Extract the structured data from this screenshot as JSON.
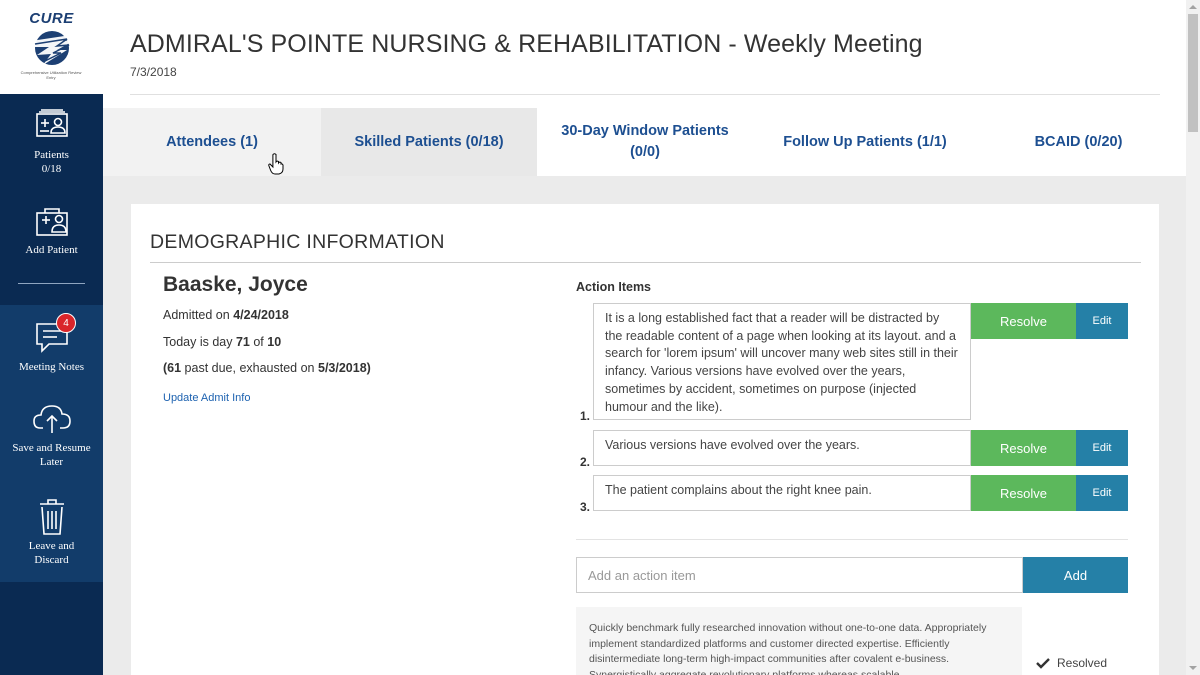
{
  "app": {
    "logo_text": "CURE",
    "logo_subtext": "Comprehensive Utilization Review Entry"
  },
  "sidebar": {
    "patients_label": "Patients",
    "patients_count": "0/18",
    "add_patient": "Add Patient",
    "meeting_notes": "Meeting Notes",
    "meeting_notes_badge": "4",
    "save_resume_line1": "Save and Resume",
    "save_resume_line2": "Later",
    "leave_discard_line1": "Leave and",
    "leave_discard_line2": "Discard"
  },
  "header": {
    "title": "ADMIRAL'S POINTE NURSING & REHABILITATION - Weekly Meeting",
    "date": "7/3/2018"
  },
  "tabs": [
    {
      "label": "Attendees (1)",
      "active": false
    },
    {
      "label": "Skilled Patients (0/18)",
      "active": true
    },
    {
      "label_line1": "30-Day Window Patients",
      "label_line2": "(0/0)",
      "active": false
    },
    {
      "label": "Follow Up Patients (1/1)",
      "active": false
    },
    {
      "label": "BCAID (0/20)",
      "active": false
    }
  ],
  "demographics": {
    "section_title": "DEMOGRAPHIC INFORMATION",
    "patient_name": "Baaske, Joyce",
    "admitted_prefix": "Admitted on ",
    "admitted_date": "4/24/2018",
    "today_prefix": "Today is day ",
    "day_number": "71",
    "day_of": " of ",
    "day_total": "10",
    "past_due_open": "(",
    "past_due_days": "61",
    "past_due_mid": " past due, exhausted on ",
    "exhausted_date": "5/3/2018)",
    "update_link": "Update Admit Info"
  },
  "action_items": {
    "title": "Action Items",
    "items": [
      {
        "num": "1.",
        "text": "It is a long established fact that a reader will be distracted by the readable content of a page when looking at its layout. and a search for 'lorem ipsum' will uncover many web sites still in their infancy. Various versions have evolved over the years, sometimes by accident, sometimes on purpose (injected humour and the like)."
      },
      {
        "num": "2.",
        "text": "Various versions have evolved over the years."
      },
      {
        "num": "3.",
        "text": "The patient complains about the right knee pain."
      }
    ],
    "resolve_label": "Resolve",
    "edit_label": "Edit",
    "input_placeholder": "Add an action item",
    "add_label": "Add",
    "resolved_note": "Quickly benchmark fully researched innovation without one-to-one data. Appropriately implement standardized platforms and customer directed expertise. Efficiently disintermediate long-term high-impact communities after covalent e-business. Synergistically aggregate revolutionary platforms whereas scalable",
    "resolved_label": "Resolved"
  },
  "colors": {
    "sidebar": "#0a2a52",
    "sidebar_lower": "#123c6a",
    "tab_text": "#1d4f91",
    "resolve_green": "#5cb85c",
    "edit_blue": "#2580a7",
    "badge_red": "#d9252a"
  }
}
